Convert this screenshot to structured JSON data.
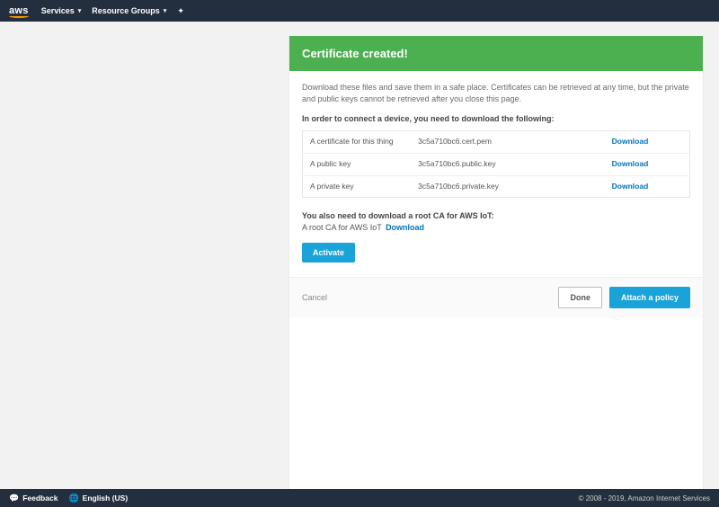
{
  "nav": {
    "logo": "aws",
    "services": "Services",
    "resource_groups": "Resource Groups"
  },
  "panel": {
    "title": "Certificate created!",
    "description": "Download these files and save them in a safe place. Certificates can be retrieved at any time, but the private and public keys cannot be retrieved after you close this page.",
    "instruction": "In order to connect a device, you need to download the following:",
    "rows": [
      {
        "label": "A certificate for this thing",
        "file": "3c5a710bc6.cert.pem",
        "action": "Download"
      },
      {
        "label": "A public key",
        "file": "3c5a710bc6.public.key",
        "action": "Download"
      },
      {
        "label": "A private key",
        "file": "3c5a710bc6.private.key",
        "action": "Download"
      }
    ],
    "root_ca_header": "You also need to download a root CA for AWS IoT:",
    "root_ca_text": "A root CA for AWS IoT",
    "root_ca_download": "Download",
    "activate": "Activate"
  },
  "footer_row": {
    "cancel": "Cancel",
    "done": "Done",
    "attach": "Attach a policy"
  },
  "bottom": {
    "feedback": "Feedback",
    "language": "English (US)",
    "copyright": "© 2008 - 2019, Amazon Internet Services"
  }
}
